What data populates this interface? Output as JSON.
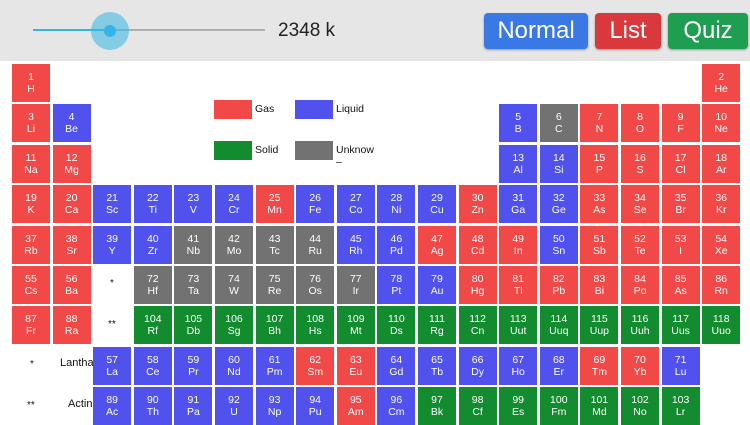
{
  "toolbar": {
    "temperature": "2348 k",
    "temperature_slider": 0.33,
    "buttons": {
      "normal": "Normal",
      "list": "List",
      "quiz": "Quiz"
    }
  },
  "colors": {
    "gas": "#f14848",
    "liquid": "#5151ee",
    "solid": "#128c2e",
    "unknown": "#727272",
    "slider": "#33b5e5",
    "btn_normal": "#3a78e6",
    "btn_list": "#d9393d",
    "btn_quiz": "#1e9e50"
  },
  "legend": [
    {
      "key": "gas",
      "label": "Gas"
    },
    {
      "key": "liquid",
      "label": "Liquid"
    },
    {
      "key": "solid",
      "label": "Solid"
    },
    {
      "key": "unknown",
      "label": "Unknow\n–"
    }
  ],
  "series_labels": {
    "lanthanoids_marker": "*",
    "lanthanoids": "Lanthanoids",
    "actinoids_marker": "**",
    "actinoids": "Actinoids",
    "period6_marker": "*",
    "period7_marker": "**"
  },
  "elements": [
    {
      "n": "1",
      "s": "H",
      "st": "gas"
    },
    {
      "n": "2",
      "s": "He",
      "st": "gas"
    },
    {
      "n": "3",
      "s": "Li",
      "st": "gas"
    },
    {
      "n": "4",
      "s": "Be",
      "st": "liquid"
    },
    {
      "n": "5",
      "s": "B",
      "st": "liquid"
    },
    {
      "n": "6",
      "s": "C",
      "st": "unknown"
    },
    {
      "n": "7",
      "s": "N",
      "st": "gas"
    },
    {
      "n": "8",
      "s": "O",
      "st": "gas"
    },
    {
      "n": "9",
      "s": "F",
      "st": "gas"
    },
    {
      "n": "10",
      "s": "Ne",
      "st": "gas"
    },
    {
      "n": "11",
      "s": "Na",
      "st": "gas"
    },
    {
      "n": "12",
      "s": "Mg",
      "st": "gas"
    },
    {
      "n": "13",
      "s": "Al",
      "st": "liquid"
    },
    {
      "n": "14",
      "s": "Si",
      "st": "liquid"
    },
    {
      "n": "15",
      "s": "P",
      "st": "gas"
    },
    {
      "n": "16",
      "s": "S",
      "st": "gas"
    },
    {
      "n": "17",
      "s": "Cl",
      "st": "gas"
    },
    {
      "n": "18",
      "s": "Ar",
      "st": "gas"
    },
    {
      "n": "19",
      "s": "K",
      "st": "gas"
    },
    {
      "n": "20",
      "s": "Ca",
      "st": "gas"
    },
    {
      "n": "21",
      "s": "Sc",
      "st": "liquid"
    },
    {
      "n": "22",
      "s": "Ti",
      "st": "liquid"
    },
    {
      "n": "23",
      "s": "V",
      "st": "liquid"
    },
    {
      "n": "24",
      "s": "Cr",
      "st": "liquid"
    },
    {
      "n": "25",
      "s": "Mn",
      "st": "gas"
    },
    {
      "n": "26",
      "s": "Fe",
      "st": "liquid"
    },
    {
      "n": "27",
      "s": "Co",
      "st": "liquid"
    },
    {
      "n": "28",
      "s": "Ni",
      "st": "liquid"
    },
    {
      "n": "29",
      "s": "Cu",
      "st": "liquid"
    },
    {
      "n": "30",
      "s": "Zn",
      "st": "gas"
    },
    {
      "n": "31",
      "s": "Ga",
      "st": "liquid"
    },
    {
      "n": "32",
      "s": "Ge",
      "st": "liquid"
    },
    {
      "n": "33",
      "s": "As",
      "st": "gas"
    },
    {
      "n": "34",
      "s": "Se",
      "st": "gas"
    },
    {
      "n": "35",
      "s": "Br",
      "st": "gas"
    },
    {
      "n": "36",
      "s": "Kr",
      "st": "gas"
    },
    {
      "n": "37",
      "s": "Rb",
      "st": "gas"
    },
    {
      "n": "38",
      "s": "Sr",
      "st": "gas"
    },
    {
      "n": "39",
      "s": "Y",
      "st": "liquid"
    },
    {
      "n": "40",
      "s": "Zr",
      "st": "liquid"
    },
    {
      "n": "41",
      "s": "Nb",
      "st": "unknown"
    },
    {
      "n": "42",
      "s": "Mo",
      "st": "unknown"
    },
    {
      "n": "43",
      "s": "Tc",
      "st": "unknown"
    },
    {
      "n": "44",
      "s": "Ru",
      "st": "unknown"
    },
    {
      "n": "45",
      "s": "Rh",
      "st": "liquid"
    },
    {
      "n": "46",
      "s": "Pd",
      "st": "liquid"
    },
    {
      "n": "47",
      "s": "Ag",
      "st": "gas"
    },
    {
      "n": "48",
      "s": "Cd",
      "st": "gas"
    },
    {
      "n": "49",
      "s": "In",
      "st": "gas"
    },
    {
      "n": "50",
      "s": "Sn",
      "st": "liquid"
    },
    {
      "n": "51",
      "s": "Sb",
      "st": "gas"
    },
    {
      "n": "52",
      "s": "Te",
      "st": "gas"
    },
    {
      "n": "53",
      "s": "I",
      "st": "gas"
    },
    {
      "n": "54",
      "s": "Xe",
      "st": "gas"
    },
    {
      "n": "55",
      "s": "Cs",
      "st": "gas"
    },
    {
      "n": "56",
      "s": "Ba",
      "st": "gas"
    },
    {
      "n": "72",
      "s": "Hf",
      "st": "unknown"
    },
    {
      "n": "73",
      "s": "Ta",
      "st": "unknown"
    },
    {
      "n": "74",
      "s": "W",
      "st": "unknown"
    },
    {
      "n": "75",
      "s": "Re",
      "st": "unknown"
    },
    {
      "n": "76",
      "s": "Os",
      "st": "unknown"
    },
    {
      "n": "77",
      "s": "Ir",
      "st": "unknown"
    },
    {
      "n": "78",
      "s": "Pt",
      "st": "liquid"
    },
    {
      "n": "79",
      "s": "Au",
      "st": "liquid"
    },
    {
      "n": "80",
      "s": "Hg",
      "st": "gas"
    },
    {
      "n": "81",
      "s": "Tl",
      "st": "gas"
    },
    {
      "n": "82",
      "s": "Pb",
      "st": "gas"
    },
    {
      "n": "83",
      "s": "Bi",
      "st": "gas"
    },
    {
      "n": "84",
      "s": "Po",
      "st": "gas"
    },
    {
      "n": "85",
      "s": "As",
      "st": "gas"
    },
    {
      "n": "86",
      "s": "Rn",
      "st": "gas"
    },
    {
      "n": "87",
      "s": "Fr",
      "st": "gas"
    },
    {
      "n": "88",
      "s": "Ra",
      "st": "gas"
    },
    {
      "n": "104",
      "s": "Rf",
      "st": "solid"
    },
    {
      "n": "105",
      "s": "Db",
      "st": "solid"
    },
    {
      "n": "106",
      "s": "Sg",
      "st": "solid"
    },
    {
      "n": "107",
      "s": "Bh",
      "st": "solid"
    },
    {
      "n": "108",
      "s": "Hs",
      "st": "solid"
    },
    {
      "n": "109",
      "s": "Mt",
      "st": "solid"
    },
    {
      "n": "110",
      "s": "Ds",
      "st": "solid"
    },
    {
      "n": "111",
      "s": "Rg",
      "st": "solid"
    },
    {
      "n": "112",
      "s": "Cn",
      "st": "solid"
    },
    {
      "n": "113",
      "s": "Uut",
      "st": "solid"
    },
    {
      "n": "114",
      "s": "Uuq",
      "st": "solid"
    },
    {
      "n": "115",
      "s": "Uup",
      "st": "solid"
    },
    {
      "n": "116",
      "s": "Uuh",
      "st": "solid"
    },
    {
      "n": "117",
      "s": "Uus",
      "st": "solid"
    },
    {
      "n": "118",
      "s": "Uuo",
      "st": "solid"
    },
    {
      "n": "57",
      "s": "La",
      "st": "liquid"
    },
    {
      "n": "58",
      "s": "Ce",
      "st": "liquid"
    },
    {
      "n": "59",
      "s": "Pr",
      "st": "liquid"
    },
    {
      "n": "60",
      "s": "Nd",
      "st": "liquid"
    },
    {
      "n": "61",
      "s": "Pm",
      "st": "liquid"
    },
    {
      "n": "62",
      "s": "Sm",
      "st": "gas"
    },
    {
      "n": "63",
      "s": "Eu",
      "st": "gas"
    },
    {
      "n": "64",
      "s": "Gd",
      "st": "liquid"
    },
    {
      "n": "65",
      "s": "Tb",
      "st": "liquid"
    },
    {
      "n": "66",
      "s": "Dy",
      "st": "liquid"
    },
    {
      "n": "67",
      "s": "Ho",
      "st": "liquid"
    },
    {
      "n": "68",
      "s": "Er",
      "st": "liquid"
    },
    {
      "n": "69",
      "s": "Tm",
      "st": "gas"
    },
    {
      "n": "70",
      "s": "Yb",
      "st": "gas"
    },
    {
      "n": "71",
      "s": "Lu",
      "st": "liquid"
    },
    {
      "n": "89",
      "s": "Ac",
      "st": "liquid"
    },
    {
      "n": "90",
      "s": "Th",
      "st": "liquid"
    },
    {
      "n": "91",
      "s": "Pa",
      "st": "liquid"
    },
    {
      "n": "92",
      "s": "U",
      "st": "liquid"
    },
    {
      "n": "93",
      "s": "Np",
      "st": "liquid"
    },
    {
      "n": "94",
      "s": "Pu",
      "st": "liquid"
    },
    {
      "n": "95",
      "s": "Am",
      "st": "gas"
    },
    {
      "n": "96",
      "s": "Cm",
      "st": "liquid"
    },
    {
      "n": "97",
      "s": "Bk",
      "st": "solid"
    },
    {
      "n": "98",
      "s": "Cf",
      "st": "solid"
    },
    {
      "n": "99",
      "s": "Es",
      "st": "solid"
    },
    {
      "n": "100",
      "s": "Fm",
      "st": "solid"
    },
    {
      "n": "101",
      "s": "Md",
      "st": "solid"
    },
    {
      "n": "102",
      "s": "No",
      "st": "solid"
    },
    {
      "n": "103",
      "s": "Lr",
      "st": "solid"
    }
  ]
}
